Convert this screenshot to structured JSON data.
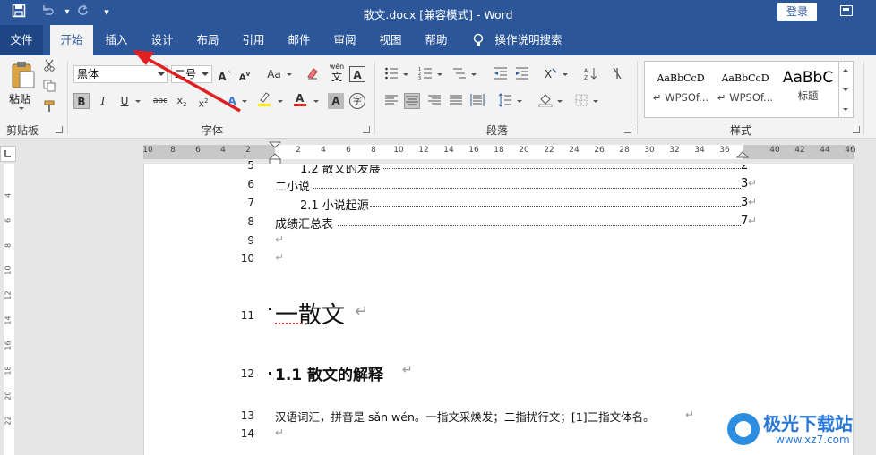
{
  "title_bar": {
    "title": "散文.docx [兼容模式]  -  Word",
    "login": "登录",
    "quick_access": [
      "save-icon",
      "undo-icon",
      "redo-icon",
      "customize-icon"
    ]
  },
  "tabs": [
    "文件",
    "开始",
    "插入",
    "设计",
    "布局",
    "引用",
    "邮件",
    "审阅",
    "视图",
    "帮助"
  ],
  "active_tab": "开始",
  "tell_me": "操作说明搜索",
  "ribbon": {
    "clipboard": {
      "label": "剪贴板",
      "paste": "粘贴"
    },
    "font": {
      "label": "字体",
      "font_name": "黑体",
      "font_size": "二号",
      "case_label": "Aa",
      "phonetic_top": "wén",
      "phonetic_bottom": "文",
      "border_char": "A",
      "enclose_char": "字"
    },
    "paragraph": {
      "label": "段落"
    },
    "styles": {
      "label": "样式",
      "items": [
        {
          "sample": "AaBbCcD",
          "name": "↵ WPSOf..."
        },
        {
          "sample": "AaBbCcD",
          "name": "↵ WPSOf..."
        },
        {
          "sample": "AaBbC",
          "name": "标题"
        }
      ]
    }
  },
  "ruler": {
    "h_numbers": [
      "10",
      "8",
      "6",
      "4",
      "2",
      "2",
      "4",
      "6",
      "8",
      "10",
      "12",
      "14",
      "16",
      "18",
      "20",
      "22",
      "24",
      "26",
      "28",
      "30",
      "32",
      "34",
      "36",
      "40",
      "42",
      "44",
      "46"
    ],
    "v_numbers": [
      "4",
      "6",
      "8",
      "10",
      "12",
      "14",
      "16",
      "18",
      "20",
      "22"
    ]
  },
  "document": {
    "lines": [
      {
        "num": "5",
        "text": "1.2 散文的发展",
        "page": "2"
      },
      {
        "num": "6",
        "text": "二小说",
        "page": "3"
      },
      {
        "num": "7",
        "text": "2.1 小说起源",
        "page": "3"
      },
      {
        "num": "8",
        "text": "成绩汇总表",
        "page": "7"
      },
      {
        "num": "9",
        "text": ""
      },
      {
        "num": "10",
        "text": ""
      },
      {
        "num": "11",
        "text": "一散文"
      },
      {
        "num": "12",
        "text": "1.1 散文的解释"
      },
      {
        "num": "13",
        "text": "汉语词汇，拼音是 sǎn wén。一指文采焕发；二指扰行文；[1]三指文体名。"
      },
      {
        "num": "14",
        "text": ""
      }
    ],
    "para_mark": "↵"
  },
  "watermark": {
    "title": "极光下载站",
    "url": "www.xz7.com"
  },
  "colors": {
    "accent": "#2b579a",
    "annotation_arrow": "#e02020"
  }
}
